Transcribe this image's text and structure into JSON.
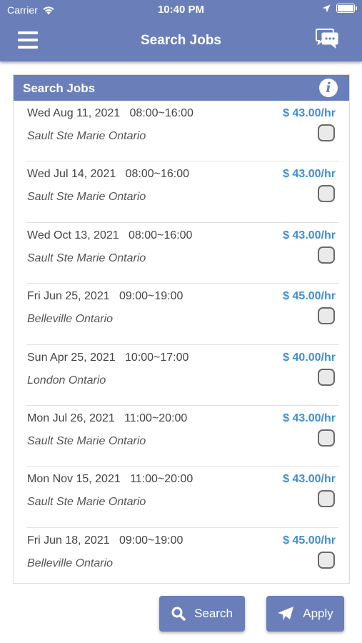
{
  "status_bar": {
    "carrier": "Carrier",
    "time": "10:40 PM"
  },
  "nav": {
    "title": "Search Jobs"
  },
  "panel": {
    "title": "Search Jobs"
  },
  "jobs": [
    {
      "date": "Wed Aug 11, 2021   08:00~16:00",
      "location": "Sault Ste Marie Ontario",
      "rate": "$ 43.00/hr"
    },
    {
      "date": "Wed Jul 14, 2021   08:00~16:00",
      "location": "Sault Ste Marie Ontario",
      "rate": "$ 43.00/hr"
    },
    {
      "date": "Wed Oct 13, 2021   08:00~16:00",
      "location": "Sault Ste Marie Ontario",
      "rate": "$ 43.00/hr"
    },
    {
      "date": "Fri Jun 25, 2021   09:00~19:00",
      "location": "Belleville Ontario",
      "rate": "$ 45.00/hr"
    },
    {
      "date": "Sun Apr 25, 2021   10:00~17:00",
      "location": "London Ontario",
      "rate": "$ 40.00/hr"
    },
    {
      "date": "Mon Jul 26, 2021   11:00~20:00",
      "location": "Sault Ste Marie Ontario",
      "rate": "$ 43.00/hr"
    },
    {
      "date": "Mon Nov 15, 2021   11:00~20:00",
      "location": "Sault Ste Marie Ontario",
      "rate": "$ 43.00/hr"
    },
    {
      "date": "Fri Jun 18, 2021   09:00~19:00",
      "location": "Belleville Ontario",
      "rate": "$ 45.00/hr"
    }
  ],
  "buttons": {
    "search": "Search",
    "apply": "Apply"
  },
  "colors": {
    "primary": "#6a7fba",
    "rate": "#3f8fd0"
  }
}
